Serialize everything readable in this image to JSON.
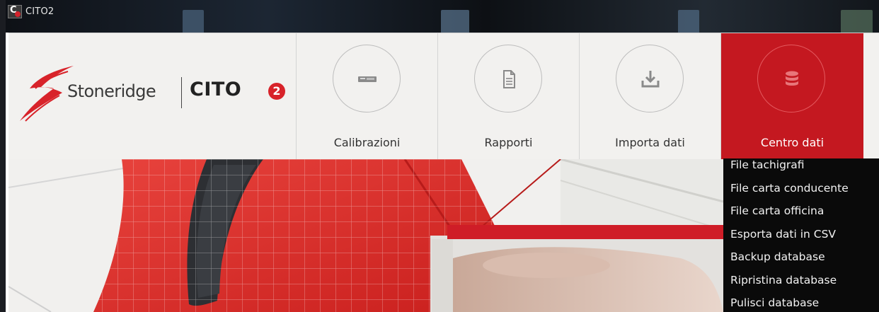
{
  "window": {
    "title": "CITO2"
  },
  "brand": {
    "company": "Stoneridge",
    "product": "CITO",
    "product_badge": "2"
  },
  "nav": {
    "tabs": [
      {
        "label": "Calibrazioni",
        "icon": "tachograph-device-icon",
        "active": false
      },
      {
        "label": "Rapporti",
        "icon": "document-icon",
        "active": false
      },
      {
        "label": "Importa dati",
        "icon": "download-tray-icon",
        "active": false
      },
      {
        "label": "Centro dati",
        "icon": "database-icon",
        "active": true
      }
    ]
  },
  "menu": {
    "items": [
      "File tachigrafi",
      "File carta conducente",
      "File carta officina",
      "Esporta dati in CSV",
      "Backup database",
      "Ripristina database",
      "Pulisci database"
    ]
  },
  "colors": {
    "accent": "#c41820",
    "header_bg": "#f2f1ef",
    "menu_bg": "#0a0a0a",
    "menu_text": "#f2f2f2"
  }
}
